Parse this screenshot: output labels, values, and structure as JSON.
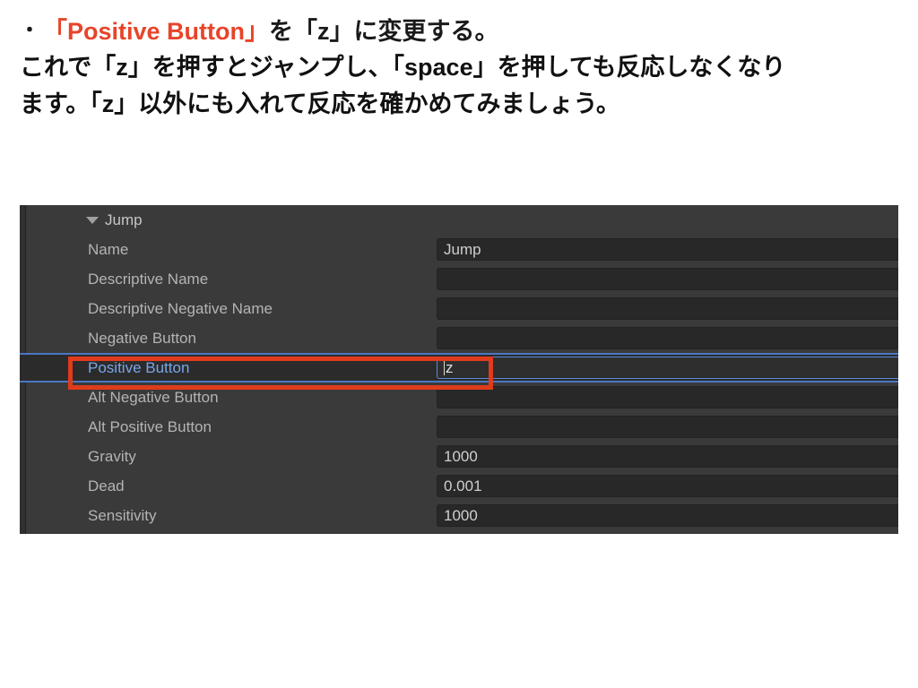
{
  "slide": {
    "bullet_marker": "・",
    "headline_segments": [
      {
        "text": "「Positive Button」",
        "accent": true
      },
      {
        "text": "を「z」に変更する。",
        "accent": false
      }
    ],
    "headline_accent_text": "「Positive Button」",
    "headline_rest_text": "を「z」に変更する。",
    "body_line_1": "これで「z」を押すとジャンプし、「space」を押しても反応しなくなり",
    "body_line_2": "ます。「z」以外にも入れて反応を確かめてみましょう。",
    "accent_color": "#E8442A",
    "text_color": "#111111"
  },
  "inspector": {
    "panel_background": "#3a3a3a",
    "field_background": "#282828",
    "selection_color": "#4a77c4",
    "selected_label_color": "#7aa5e8",
    "annotation_color": "#E03B1C",
    "foldout_icon": "triangle-down-icon",
    "group_label": "Jump",
    "rows": [
      {
        "label": "Name",
        "value": "Jump",
        "selected": false
      },
      {
        "label": "Descriptive Name",
        "value": "",
        "selected": false
      },
      {
        "label": "Descriptive Negative Name",
        "value": "",
        "selected": false
      },
      {
        "label": "Negative Button",
        "value": "",
        "selected": false
      },
      {
        "label": "Positive Button",
        "value": "z",
        "selected": true
      },
      {
        "label": "Alt Negative Button",
        "value": "",
        "selected": false
      },
      {
        "label": "Alt Positive Button",
        "value": "",
        "selected": false
      },
      {
        "label": "Gravity",
        "value": "1000",
        "selected": false
      },
      {
        "label": "Dead",
        "value": "0.001",
        "selected": false
      },
      {
        "label": "Sensitivity",
        "value": "1000",
        "selected": false
      }
    ]
  }
}
